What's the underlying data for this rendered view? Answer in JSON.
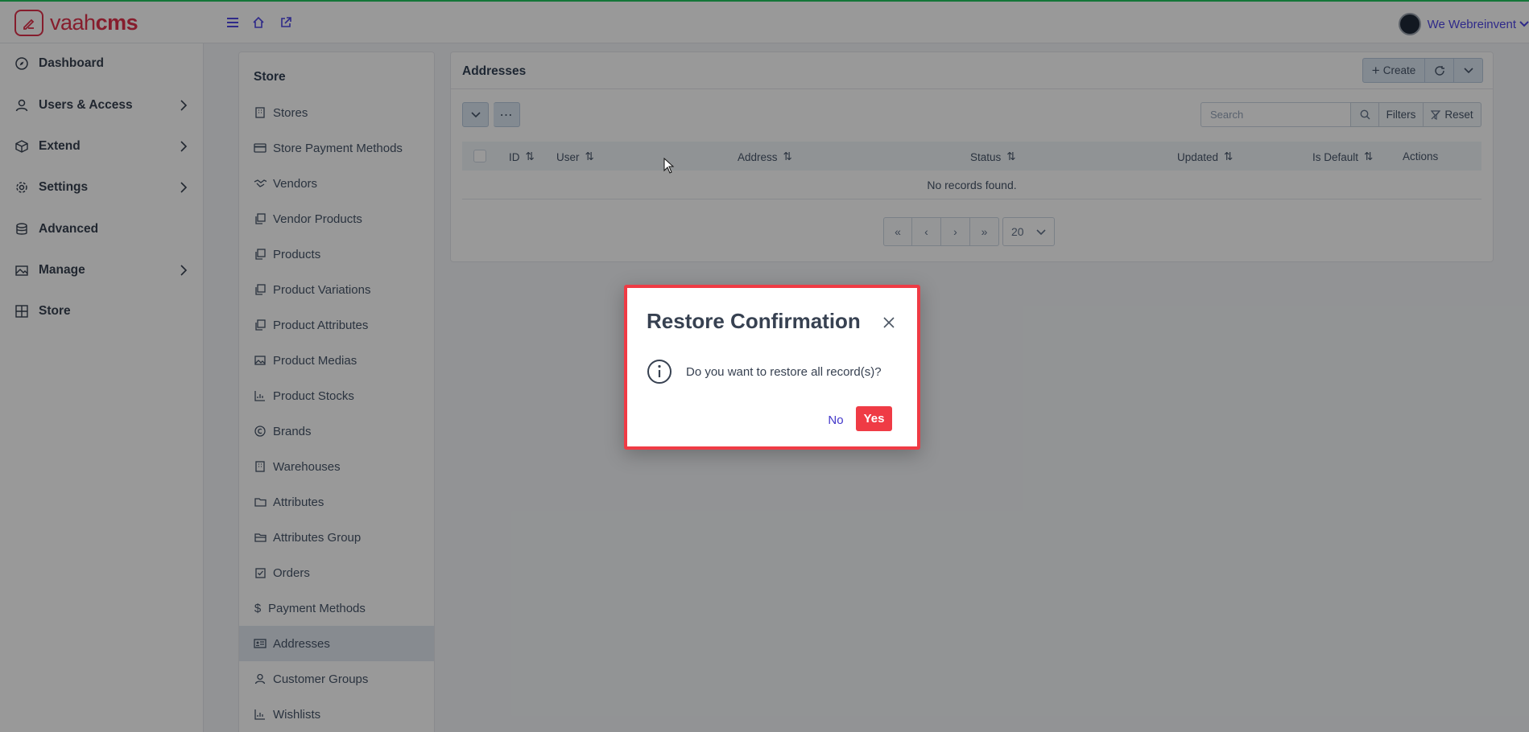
{
  "brand": {
    "name_light": "vaah",
    "name_bold": "cms",
    "color": "#e0314b"
  },
  "topbar": {
    "user_name": "We Webreinvent",
    "accent": "#4f46e5"
  },
  "sidebar": {
    "items": [
      {
        "label": "Dashboard",
        "icon": "compass-icon",
        "has_submenu": false
      },
      {
        "label": "Users & Access",
        "icon": "user-icon",
        "has_submenu": true
      },
      {
        "label": "Extend",
        "icon": "box-icon",
        "has_submenu": true
      },
      {
        "label": "Settings",
        "icon": "gear-icon",
        "has_submenu": true
      },
      {
        "label": "Advanced",
        "icon": "database-icon",
        "has_submenu": false
      },
      {
        "label": "Manage",
        "icon": "images-icon",
        "has_submenu": true
      },
      {
        "label": "Store",
        "icon": "grid-icon",
        "has_submenu": false
      }
    ]
  },
  "store_menu": {
    "title": "Store",
    "active": "Addresses",
    "items": [
      {
        "label": "Stores",
        "icon": "building-icon"
      },
      {
        "label": "Store Payment Methods",
        "icon": "credit-card-icon"
      },
      {
        "label": "Vendors",
        "icon": "handshake-icon"
      },
      {
        "label": "Vendor Products",
        "icon": "clone-icon"
      },
      {
        "label": "Products",
        "icon": "clone-icon"
      },
      {
        "label": "Product Variations",
        "icon": "clone-icon"
      },
      {
        "label": "Product Attributes",
        "icon": "clone-icon"
      },
      {
        "label": "Product Medias",
        "icon": "image-icon"
      },
      {
        "label": "Product Stocks",
        "icon": "chart-bar-icon"
      },
      {
        "label": "Brands",
        "icon": "copyright-icon"
      },
      {
        "label": "Warehouses",
        "icon": "building-icon"
      },
      {
        "label": "Attributes",
        "icon": "folder-icon"
      },
      {
        "label": "Attributes Group",
        "icon": "folder-open-icon"
      },
      {
        "label": "Orders",
        "icon": "check-square-icon"
      },
      {
        "label": "Payment Methods",
        "icon": "dollar-icon"
      },
      {
        "label": "Addresses",
        "icon": "id-card-icon"
      },
      {
        "label": "Customer Groups",
        "icon": "user-icon"
      },
      {
        "label": "Wishlists",
        "icon": "chart-bar-icon"
      }
    ]
  },
  "main": {
    "title": "Addresses",
    "create_label": "Create",
    "search_placeholder": "Search",
    "filters_label": "Filters",
    "reset_label": "Reset",
    "columns": [
      "ID",
      "User",
      "Address",
      "Status",
      "Updated",
      "Is Default",
      "Actions"
    ],
    "empty_message": "No records found.",
    "rows_per_page": "20"
  },
  "dialog": {
    "title": "Restore Confirmation",
    "message": "Do you want to restore all record(s)?",
    "no_label": "No",
    "yes_label": "Yes",
    "accent": "#ef3b45"
  }
}
